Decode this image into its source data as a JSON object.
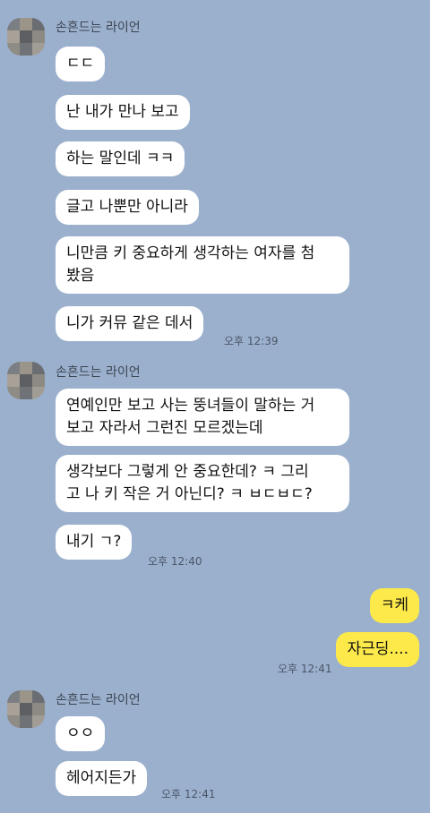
{
  "chat": {
    "groups": [
      {
        "sender": "손흔드는 라이언",
        "messages": [
          "ㄷㄷ",
          "난 내가 만나 보고",
          "하는 말인데 ㅋㅋ",
          "글고 나뿐만 아니라",
          "니만큼 키 중요하게 생각하는 여자를 첨\n봤음",
          "니가 커뮤 같은 데서"
        ],
        "time": "오후 12:39"
      },
      {
        "sender": "손흔드는 라이언",
        "messages": [
          "연예인만 보고 사는 뚱녀들이 말하는 거\n보고 자라서 그런진 모르겠는데",
          "생각보다 그렇게 안 중요한데? ㅋ 그리\n고 나 키 작은 거 아닌디? ㅋ ㅂㄷㅂㄷ?",
          "내기 ㄱ?"
        ],
        "time": "오후 12:40"
      },
      {
        "sender": "me",
        "messages": [
          "ㅋ케",
          "자근딩...."
        ],
        "time": "오후 12:41"
      },
      {
        "sender": "손흔드는 라이언",
        "messages": [
          "ㅇㅇ",
          "헤어지든가"
        ],
        "time": "오후 12:41"
      }
    ]
  },
  "colors": {
    "background": "#9bb0cd",
    "incoming_bubble": "#ffffff",
    "outgoing_bubble": "#fde94a"
  }
}
